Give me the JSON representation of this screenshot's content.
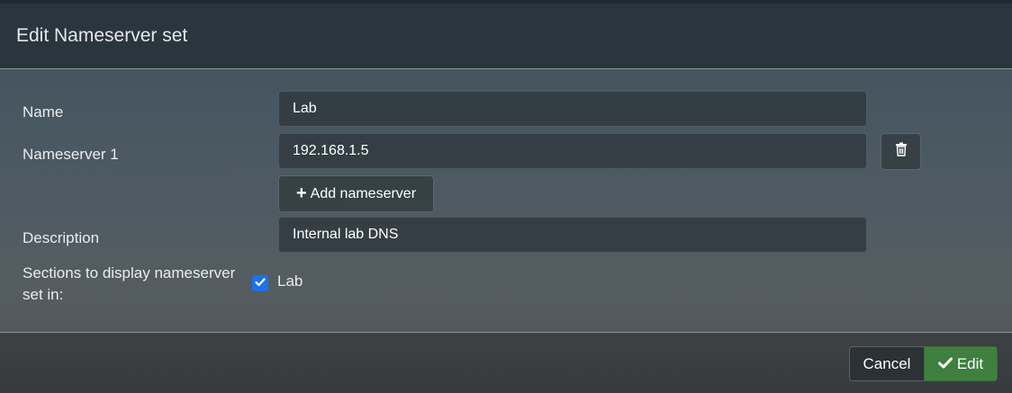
{
  "dialog": {
    "title": "Edit Nameserver set"
  },
  "form": {
    "name": {
      "label": "Name",
      "value": "Lab"
    },
    "nameservers": [
      {
        "label": "Nameserver 1",
        "value": "192.168.1.5"
      }
    ],
    "add_nameserver_label": "Add nameserver",
    "description": {
      "label": "Description",
      "value": "Internal lab DNS"
    },
    "sections": {
      "label": "Sections to display nameserver set in:",
      "options": [
        {
          "label": "Lab",
          "checked": true
        }
      ]
    }
  },
  "footer": {
    "cancel_label": "Cancel",
    "edit_label": "Edit"
  },
  "colors": {
    "primary_action": "#3f7f3f",
    "checkbox": "#1a73e8"
  },
  "icons": [
    "trash-icon",
    "plus-icon",
    "checkmark-icon",
    "checkbox-checked-icon"
  ]
}
